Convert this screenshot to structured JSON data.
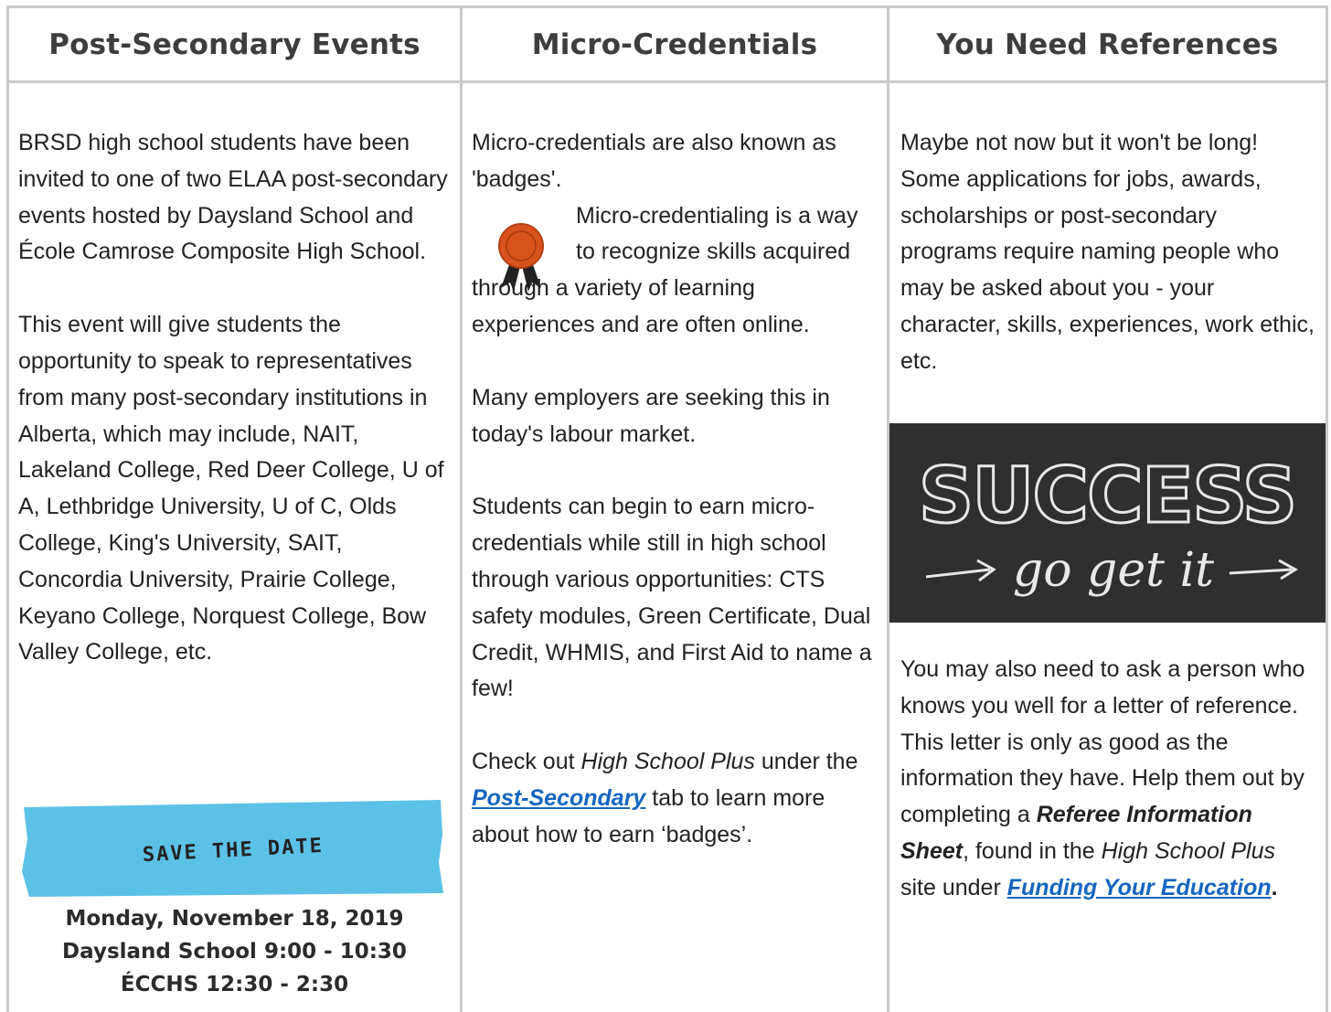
{
  "columns": [
    {
      "title": "Post-Secondary Events",
      "para1": "BRSD high school students have been invited to one of two ELAA post-secondary events hosted by Daysland School and École Camrose Composite High School.",
      "para2": "This event will give students the opportunity to speak to representatives from many post-secondary institutions in Alberta, which may include, NAIT, Lakeland College, Red Deer College, U of A, Lethbridge University, U of C,  Olds College, King's University, SAIT, Concordia University, Prairie College, Keyano College, Norquest College, Bow Valley College, etc.",
      "save_the_date": "SAVE THE DATE",
      "date_line1": "Monday, November 18, 2019",
      "date_line2": "Daysland School 9:00 - 10:30",
      "date_line3": "ÉCCHS 12:30 - 2:30"
    },
    {
      "title": "Micro-Credentials",
      "para1a": "Micro-credentials are also known as 'badges'.",
      "para1b": "Micro-credentialing is a way to recognize skills acquired",
      "para1c": "through a variety of learning experiences and are often online.",
      "para2": "Many employers are seeking this in today's labour market.",
      "para3": "Students can begin to earn micro-credentials while still in high school through various opportunities: CTS safety modules, Green Certificate, Dual Credit, WHMIS, and First Aid to name a few!",
      "para4_pre": "Check out ",
      "para4_em": "High School Plus",
      "para4_mid": " under the ",
      "para4_link": "Post-Secondary",
      "para4_post": " tab to learn more about how to earn ‘badges’."
    },
    {
      "title": "You Need References",
      "para1": "Maybe not now but it won't be long! Some applications for jobs, awards, scholarships or post-secondary programs require naming people who may be asked about you - your character, skills, experiences, work ethic, etc.",
      "image_text1": "SUCCESS",
      "image_text2": "go get it",
      "para2_pre": "You may also need to ask a person who knows you well for a letter of reference. This letter is only as good as the information they have. Help them out by completing a ",
      "para2_bold": "Referee Information Sheet",
      "para2_mid": ", found in the ",
      "para2_em": "High School Plus",
      "para2_mid2": " site under ",
      "para2_link": "Funding Your Education",
      "para2_end": "."
    }
  ],
  "colors": {
    "border": "#c9c9c9",
    "link": "#1565c0",
    "banner": "#5cc1e6",
    "badge": "#d9531e",
    "chalkboard": "#2a2a2a"
  },
  "icons": [
    "award-ribbon-icon"
  ]
}
